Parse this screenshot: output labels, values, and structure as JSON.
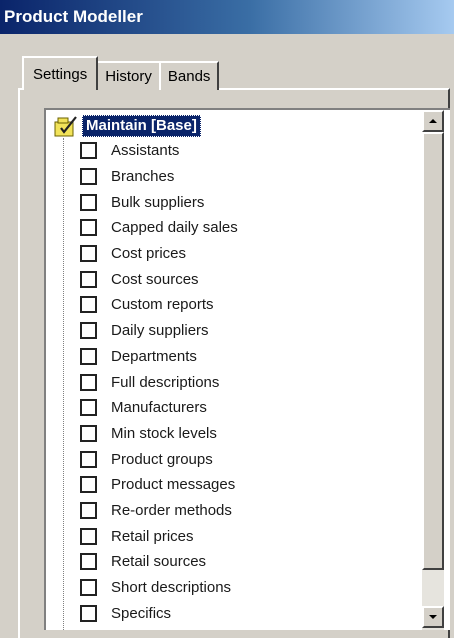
{
  "window": {
    "title": "Product Modeller"
  },
  "tabs": [
    {
      "label": "Settings",
      "active": true
    },
    {
      "label": "History",
      "active": false
    },
    {
      "label": "Bands",
      "active": false
    }
  ],
  "tree": {
    "root": {
      "label": "Maintain [Base]",
      "icon": "folder-checklist-icon"
    },
    "items": [
      {
        "label": "Assistants",
        "checked": false
      },
      {
        "label": "Branches",
        "checked": false
      },
      {
        "label": "Bulk suppliers",
        "checked": false
      },
      {
        "label": "Capped daily sales",
        "checked": false
      },
      {
        "label": "Cost prices",
        "checked": false
      },
      {
        "label": "Cost sources",
        "checked": false
      },
      {
        "label": "Custom reports",
        "checked": false
      },
      {
        "label": "Daily suppliers",
        "checked": false
      },
      {
        "label": "Departments",
        "checked": false
      },
      {
        "label": "Full descriptions",
        "checked": false
      },
      {
        "label": "Manufacturers",
        "checked": false
      },
      {
        "label": "Min stock levels",
        "checked": false
      },
      {
        "label": "Product groups",
        "checked": false
      },
      {
        "label": "Product messages",
        "checked": false
      },
      {
        "label": "Re-order methods",
        "checked": false
      },
      {
        "label": "Retail prices",
        "checked": false
      },
      {
        "label": "Retail sources",
        "checked": false
      },
      {
        "label": "Short descriptions",
        "checked": false
      },
      {
        "label": "Specifics",
        "checked": false
      }
    ]
  },
  "colors": {
    "titlebar_start": "#0a246a",
    "titlebar_end": "#a6caf0",
    "selection": "#0a246a",
    "face": "#d4d0c8"
  }
}
